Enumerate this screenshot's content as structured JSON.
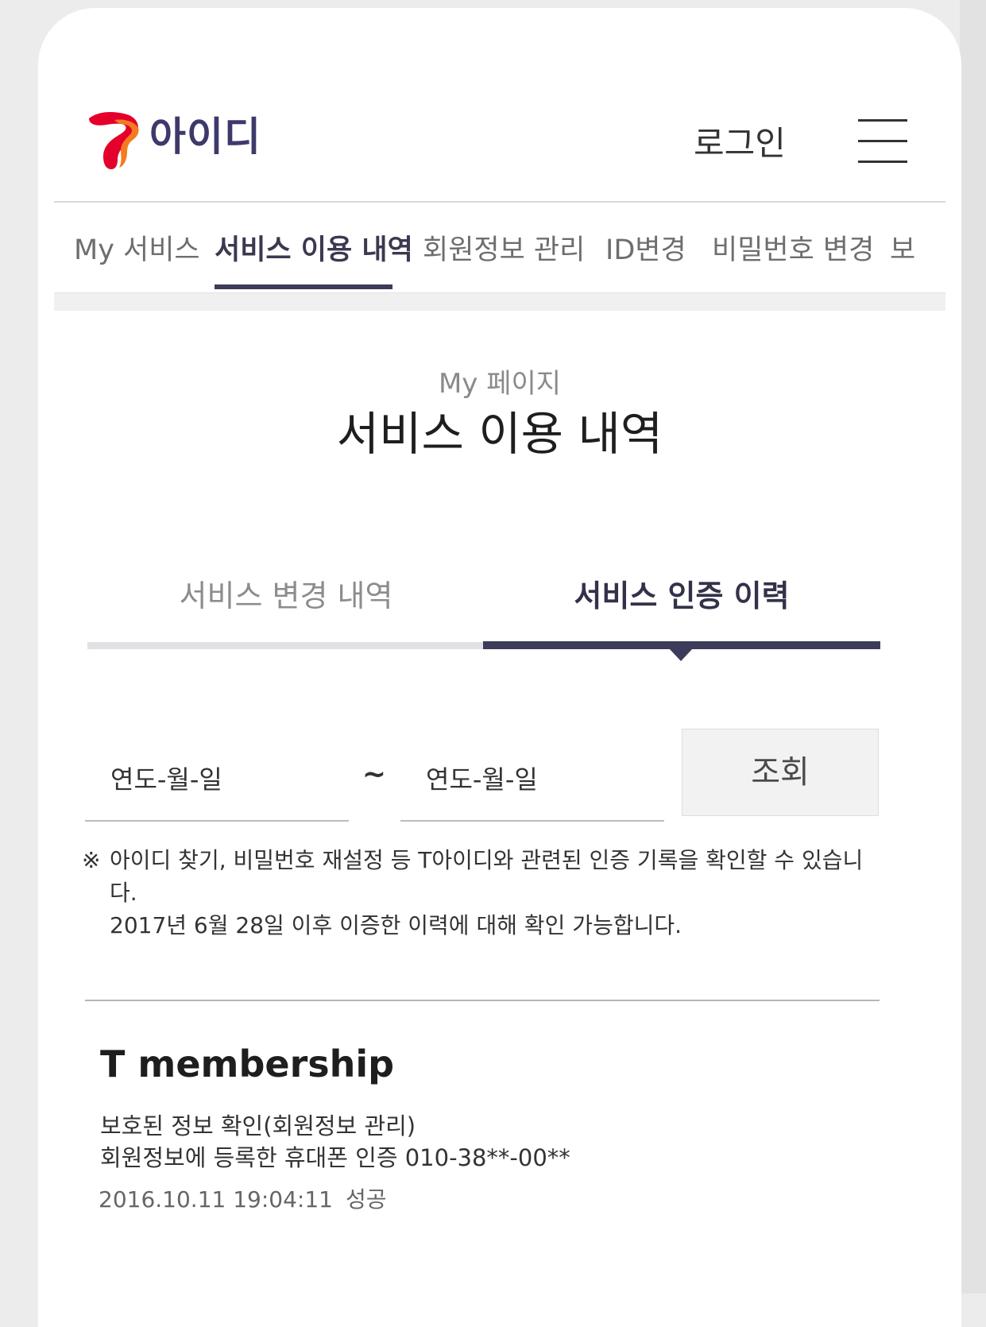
{
  "header": {
    "brand": "아이디",
    "login_label": "로그인"
  },
  "nav": {
    "items": [
      {
        "label": "My 서비스"
      },
      {
        "label": "서비스 이용 내역"
      },
      {
        "label": "회원정보 관리"
      },
      {
        "label": "ID변경"
      },
      {
        "label": "비밀번호 변경"
      },
      {
        "label": "보"
      }
    ],
    "active_index": 1
  },
  "page": {
    "subtitle": "My 페이지",
    "title": "서비스 이용 내역"
  },
  "subtabs": {
    "items": [
      {
        "label": "서비스 변경 내역"
      },
      {
        "label": "서비스 인증 이력"
      }
    ],
    "active_index": 1
  },
  "search": {
    "start_placeholder": "연도-월-일",
    "separator": "~",
    "end_placeholder": "연도-월-일",
    "button_label": "조회"
  },
  "notice": {
    "mark": "※",
    "line1": "아이디 찾기, 비밀번호 재설정 등 T아이디와 관련된 인증 기록을 확인할 수 있습니다.",
    "line2": "2017년 6월 28일 이후 이증한 이력에 대해 확인 가능합니다."
  },
  "records": [
    {
      "service": "T membership",
      "detail1": "보호된 정보 확인(회원정보 관리)",
      "detail2": "회원정보에 등록한 휴대폰 인증 010-38**-00**",
      "datetime": "2016.10.11 19:04:11",
      "status": "성공"
    }
  ],
  "colors": {
    "brand_text": "#3d3a6b",
    "active_indicator": "#3c3b59",
    "logo_red": "#e4002b",
    "logo_orange": "#f47b20"
  },
  "icons": {
    "logo": "t-logo-icon",
    "menu": "hamburger-menu-icon",
    "active_tab_pointer": "caret-down-icon"
  }
}
